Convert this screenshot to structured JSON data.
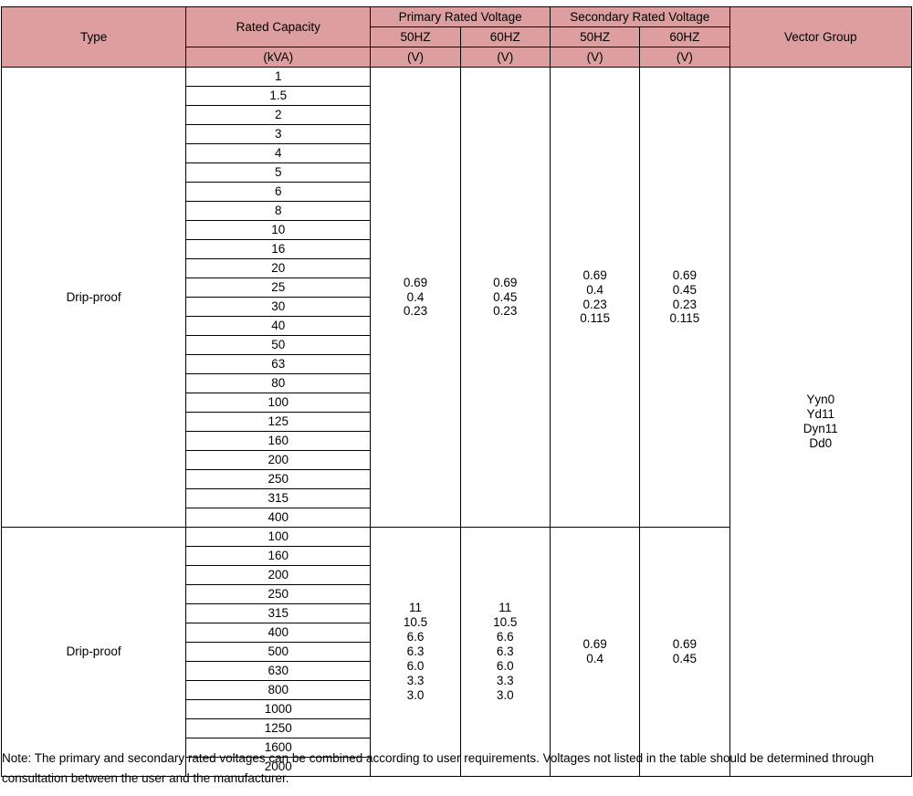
{
  "table": {
    "header": {
      "type": "Type",
      "rated_capacity": "Rated Capacity",
      "rated_capacity_unit": "(kVA)",
      "primary_rated_voltage": "Primary Rated Voltage",
      "secondary_rated_voltage": "Secondary Rated Voltage",
      "vector_group": "Vector Group",
      "freq_50": "50HZ",
      "freq_60": "60HZ",
      "volt_unit": "(V)"
    },
    "sections": [
      {
        "type": "Drip-proof",
        "capacities": [
          "1",
          "1.5",
          "2",
          "3",
          "4",
          "5",
          "6",
          "8",
          "10",
          "16",
          "20",
          "25",
          "30",
          "40",
          "50",
          "63",
          "80",
          "100",
          "125",
          "160",
          "200",
          "250",
          "315",
          "400"
        ],
        "primary_50hz": [
          "0.69",
          "0.4",
          "0.23"
        ],
        "primary_60hz": [
          "0.69",
          "0.45",
          "0.23"
        ],
        "secondary_50hz": [
          "0.69",
          "0.4",
          "0.23",
          "0.115"
        ],
        "secondary_60hz": [
          "0.69",
          "0.45",
          "0.23",
          "0.115"
        ]
      },
      {
        "type": "Drip-proof",
        "capacities": [
          "100",
          "160",
          "200",
          "250",
          "315",
          "400",
          "500",
          "630",
          "800",
          "1000",
          "1250",
          "1600",
          "2000"
        ],
        "primary_50hz": [
          "11",
          "10.5",
          "6.6",
          "6.3",
          "6.0",
          "3.3",
          "3.0"
        ],
        "primary_60hz": [
          "11",
          "10.5",
          "6.6",
          "6.3",
          "6.0",
          "3.3",
          "3.0"
        ],
        "secondary_50hz": [
          "0.69",
          "0.4"
        ],
        "secondary_60hz": [
          "0.69",
          "0.45"
        ]
      }
    ],
    "vector_group_values": [
      "Yyn0",
      "Yd11",
      "Dyn11",
      "Dd0"
    ]
  },
  "note": {
    "text": "Note: The primary and secondary rated voltages can be combined according to user requirements. Voltages not listed in the table should be determined through consultation between the user and the manufacturer."
  },
  "colors": {
    "header_background": "#dc9e9e",
    "border": "#000000",
    "text": "#000000",
    "page_background": "#ffffff"
  }
}
